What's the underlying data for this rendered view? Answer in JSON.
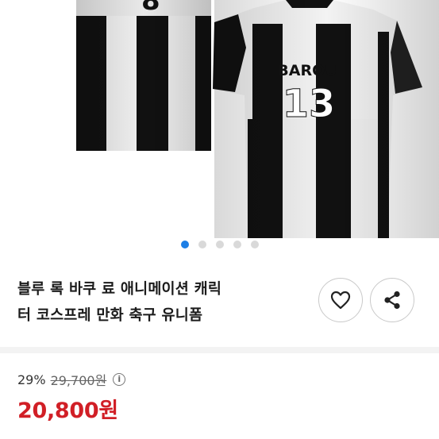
{
  "product": {
    "images": {
      "jersey_name": "BAROU",
      "jersey_number": "13",
      "back_number_partial": "8",
      "dots_total": 5,
      "dots_active_index": 0
    },
    "title_line1": "블루 록 바쿠 료 애니메이션 캐릭",
    "title_line2": "터 코스프레 만화 축구 유니폼",
    "discount_percent": "29%",
    "original_price": "29,700원",
    "info_symbol": "i",
    "sale_price": "20,800원"
  },
  "colors": {
    "accent_dot": "#1d7fe6",
    "price_red": "#d11f26",
    "jersey_black": "#111111",
    "jersey_white": "#f2f2f2"
  },
  "icons": {
    "like": "heart-icon",
    "share": "share-icon",
    "info": "info-icon"
  }
}
